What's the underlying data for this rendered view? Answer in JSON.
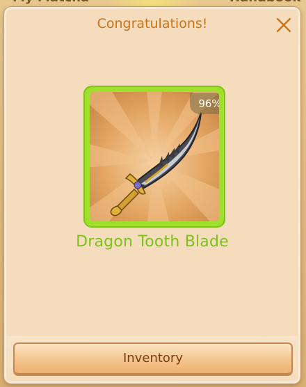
{
  "background": {
    "left_tab_label": "My Matcha",
    "right_tab_label": "Handbook"
  },
  "dialog": {
    "title": "Congratulations!",
    "close_icon": "close-icon"
  },
  "reward": {
    "item_name": "Dragon Tooth Blade",
    "quality_percent": "96%",
    "item_icon": "sword-icon"
  },
  "footer": {
    "inventory_label": "Inventory"
  },
  "colors": {
    "title": "#c9731a",
    "item_name": "#7cc21a",
    "frame": "#9ee02a",
    "button_text": "#7a3e12"
  }
}
